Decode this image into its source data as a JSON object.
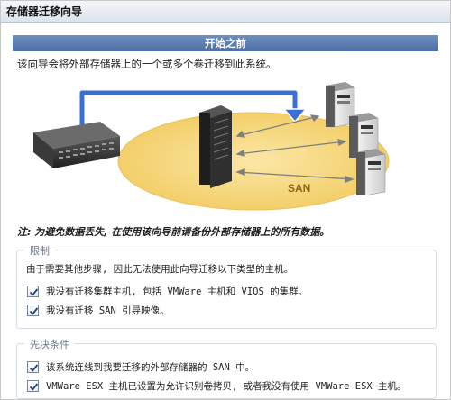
{
  "window": {
    "title": "存储器迁移向导"
  },
  "banner": {
    "title": "开始之前"
  },
  "intro": {
    "text": "该向导会将外部存储器上的一个或多个卷迁移到此系统。"
  },
  "diagram": {
    "san_label": "SAN",
    "colors": {
      "san_ellipse": "#f6d77c",
      "arrow_blue": "#3b6fd1",
      "server_dark": "#2b2b2b"
    }
  },
  "warning": {
    "text": "注: 为避免数据丢失, 在使用该向导前请备份外部存储器上的所有数据。"
  },
  "restrictions": {
    "title": "限制",
    "description": "由于需要其他步骤, 因此无法使用此向导迁移以下类型的主机。",
    "items": [
      {
        "label": "我没有迁移集群主机, 包括 VMWare 主机和 VIOS 的集群。",
        "checked": true
      },
      {
        "label": "我没有迁移 SAN 引导映像。",
        "checked": true
      }
    ]
  },
  "prerequisites": {
    "title": "先决条件",
    "items": [
      {
        "label": "该系统连线到我要迁移的外部存储器的 SAN 中。",
        "checked": true
      },
      {
        "label": "VMWare ESX 主机已设置为允许识别卷拷贝, 或者我没有使用 VMWare ESX 主机。",
        "checked": true
      }
    ]
  }
}
